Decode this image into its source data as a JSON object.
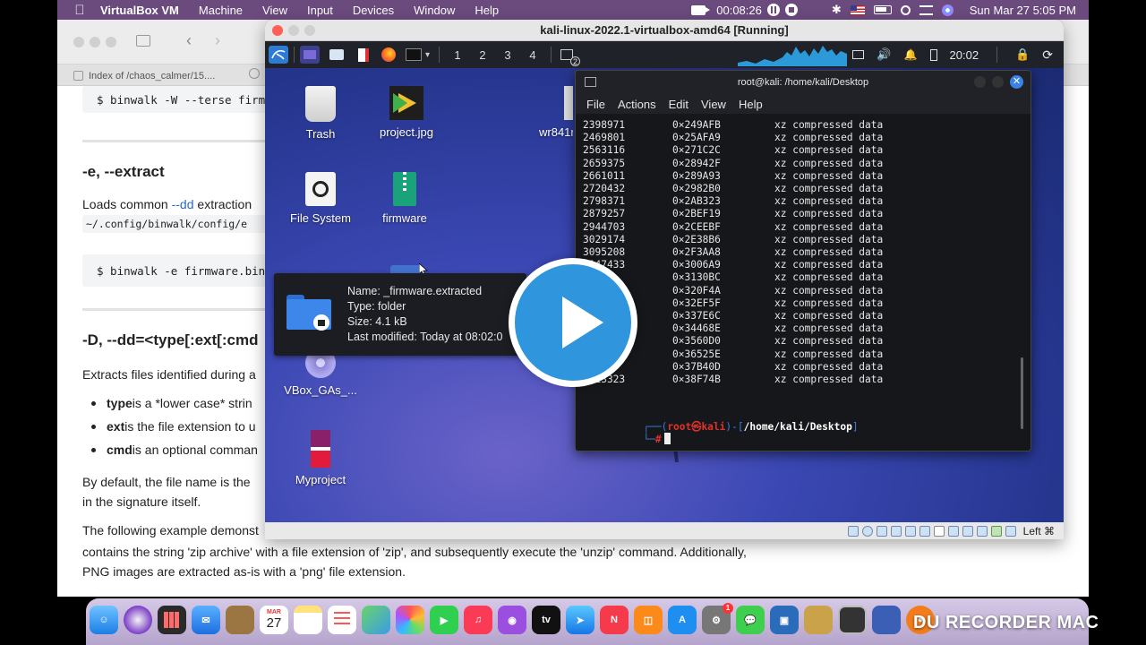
{
  "mac_menubar": {
    "app_name": "VirtualBox VM",
    "menus": [
      "Machine",
      "View",
      "Input",
      "Devices",
      "Window",
      "Help"
    ],
    "record_time": "00:08:26",
    "date_time": "Sun Mar 27  5:05 PM"
  },
  "browser": {
    "tab_title": "Index of /chaos_calmer/15....",
    "doc": {
      "code1": "$ binwalk -W --terse firm",
      "heading1": "-e, --extract",
      "p1_prefix": "Loads common ",
      "p1_link": "--dd",
      "p1_suffix": " extraction",
      "p1_path": "~/.config/binwalk/config/e",
      "code2": "$ binwalk -e firmware.bin",
      "heading2": "-D, --dd=<type[:ext[:cmd",
      "p2": "Extracts files identified during a",
      "bullets": [
        {
          "bold": "type",
          "rest": " is a *lower case* strin"
        },
        {
          "bold": "ext",
          "rest": " is the file extension to u"
        },
        {
          "bold": "cmd",
          "rest": " is an optional comman"
        }
      ],
      "p3_line1": "By default, the file name is the",
      "p3_line2": "in the signature itself.",
      "p4_line1": "The following example demonst",
      "p4_line1_end": "contains the string 'zip archive' with a file extension of 'zip', and subsequently execute the 'unzip' command. Additionally,",
      "p4_line2": "PNG images are extracted as-is with a 'png' file extension."
    }
  },
  "vbox": {
    "title": "kali-linux-2022.1-virtualbox-amd64 [Running]",
    "status_host_key": "Left ⌘",
    "panel": {
      "workspaces": [
        "1",
        "2",
        "3",
        "4"
      ],
      "window_badge": "2",
      "clock": "20:02"
    },
    "desktop_icons": [
      {
        "label": "Trash"
      },
      {
        "label": "project.jpg"
      },
      {
        "label": "wr841n"
      },
      {
        "label": "File System"
      },
      {
        "label": "firmware"
      },
      {
        "label": "VBox_GAs_..."
      },
      {
        "label": "Myproject"
      }
    ],
    "tooltip": {
      "name": "Name: _firmware.extracted",
      "type": "Type: folder",
      "size": "Size: 4.1 kB",
      "modified": "Last modified: Today at 08:02:0"
    },
    "terminal": {
      "title": "root@kali: /home/kali/Desktop",
      "menu": [
        "File",
        "Actions",
        "Edit",
        "View",
        "Help"
      ],
      "rows": [
        {
          "dec": "2398971",
          "hex": "0×249AFB",
          "desc": "xz compressed data"
        },
        {
          "dec": "2469801",
          "hex": "0×25AFA9",
          "desc": "xz compressed data"
        },
        {
          "dec": "2563116",
          "hex": "0×271C2C",
          "desc": "xz compressed data"
        },
        {
          "dec": "2659375",
          "hex": "0×28942F",
          "desc": "xz compressed data"
        },
        {
          "dec": "2661011",
          "hex": "0×289A93",
          "desc": "xz compressed data"
        },
        {
          "dec": "2720432",
          "hex": "0×2982B0",
          "desc": "xz compressed data"
        },
        {
          "dec": "2798371",
          "hex": "0×2AB323",
          "desc": "xz compressed data"
        },
        {
          "dec": "2879257",
          "hex": "0×2BEF19",
          "desc": "xz compressed data"
        },
        {
          "dec": "2944703",
          "hex": "0×2CEEBF",
          "desc": "xz compressed data"
        },
        {
          "dec": "3029174",
          "hex": "0×2E38B6",
          "desc": "xz compressed data"
        },
        {
          "dec": "3095208",
          "hex": "0×2F3AA8",
          "desc": "xz compressed data"
        },
        {
          "dec": "3147433",
          "hex": "0×3006A9",
          "desc": "xz compressed data"
        },
        {
          "dec": "",
          "hex": "0×3130BC",
          "desc": "xz compressed data"
        },
        {
          "dec": "",
          "hex": "0×320F4A",
          "desc": "xz compressed data"
        },
        {
          "dec": "",
          "hex": "0×32EF5F",
          "desc": "xz compressed data"
        },
        {
          "dec": "",
          "hex": "0×337E6C",
          "desc": "xz compressed data"
        },
        {
          "dec": "",
          "hex": "0×34468E",
          "desc": "xz compressed data"
        },
        {
          "dec": "",
          "hex": "0×3560D0",
          "desc": "xz compressed data"
        },
        {
          "dec": "",
          "hex": "0×36525E",
          "desc": "xz compressed data"
        },
        {
          "dec": "3",
          "hex": "0×37B40D",
          "desc": "xz compressed data"
        },
        {
          "dec": "3713323",
          "hex": "0×38F74B",
          "desc": "xz compressed data"
        }
      ],
      "prompt_user": "root㉿kali",
      "prompt_path": "/home/kali/Desktop",
      "prompt_symbol": "#"
    }
  },
  "dock": {
    "calendar_month": "MAR",
    "calendar_day": "27",
    "badge": "1"
  },
  "overlay": {
    "recorder_text": "DU RECORDER MAC"
  }
}
